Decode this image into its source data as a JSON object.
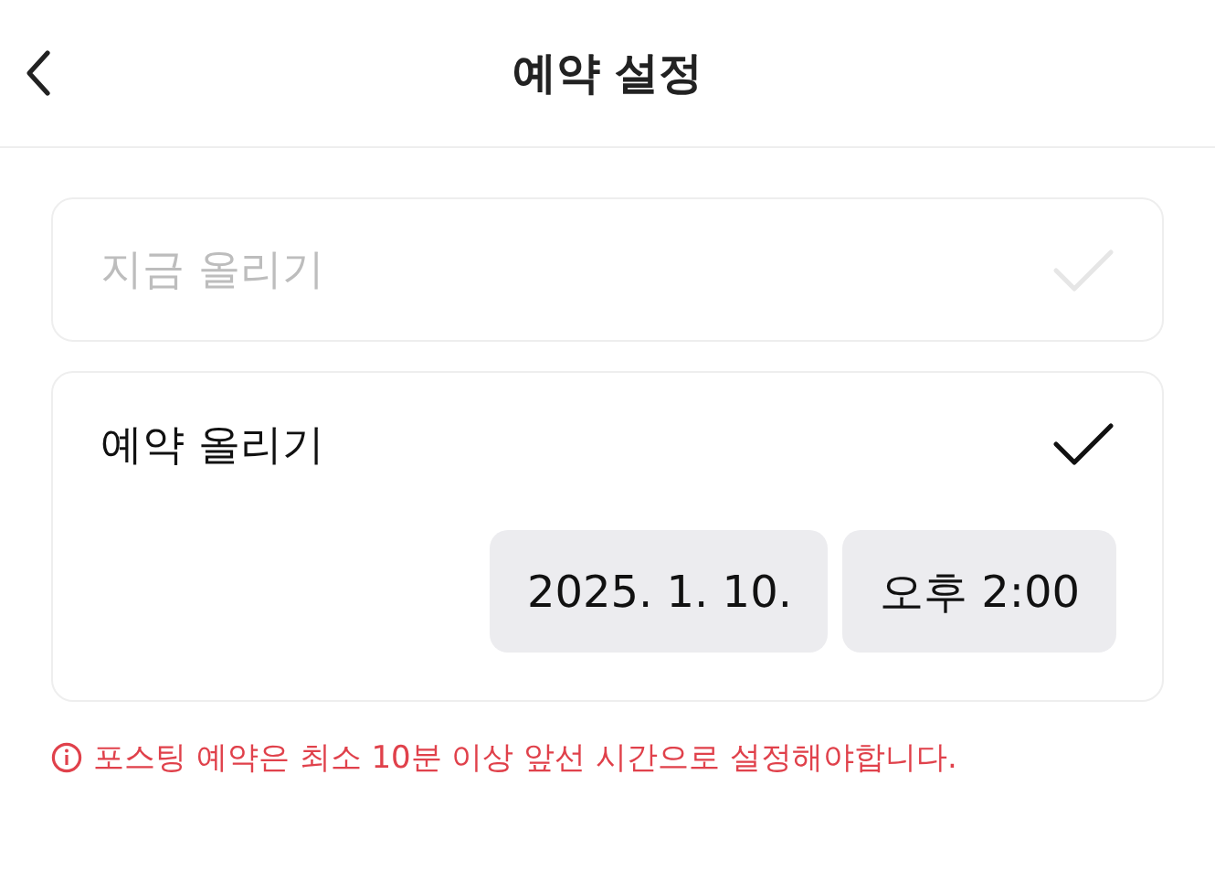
{
  "header": {
    "title": "예약 설정"
  },
  "options": [
    {
      "label": "지금 올리기",
      "selected": false
    },
    {
      "label": "예약 올리기",
      "selected": true,
      "date": "2025. 1. 10.",
      "time": "오후 2:00"
    }
  ],
  "error": "포스팅 예약은 최소 10분 이상 앞선 시간으로 설정해야합니다."
}
